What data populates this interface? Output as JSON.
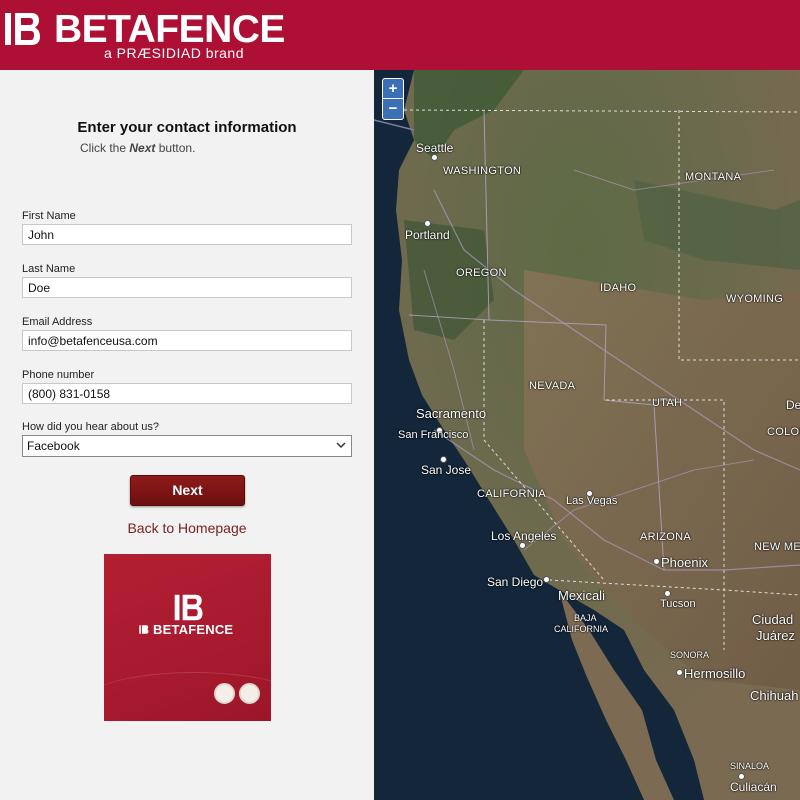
{
  "brand": {
    "name": "BETAFENCE",
    "tagline": "a PRÆSIDIAD brand"
  },
  "form": {
    "title": "Enter your contact information",
    "subtitle_prefix": "Click the",
    "subtitle_emph": "Next",
    "subtitle_suffix": "button.",
    "first_name": {
      "label": "First Name",
      "value": "John"
    },
    "last_name": {
      "label": "Last Name",
      "value": "Doe"
    },
    "email": {
      "label": "Email Address",
      "value": "info@betafenceusa.com"
    },
    "phone": {
      "label": "Phone number",
      "value": "(800) 831-0158"
    },
    "source": {
      "label": "How did you hear about us?",
      "selected": "Facebook"
    },
    "next_label": "Next",
    "back_label": "Back to Homepage"
  },
  "promo": {
    "word": "BETAFENCE"
  },
  "map": {
    "zoom_in": "+",
    "zoom_out": "−",
    "labels": {
      "seattle": "Seattle",
      "washington": "WASHINGTON",
      "montana": "MONTANA",
      "portland": "Portland",
      "oregon": "OREGON",
      "idaho": "IDAHO",
      "wyoming": "WYOMING",
      "nevada": "NEVADA",
      "sacramento": "Sacramento",
      "san_francisco": "San Francisco",
      "utah": "UTAH",
      "de": "De",
      "colo": "COLOI",
      "san_jose": "San Jose",
      "california": "CALIFORNIA",
      "las_vegas": "Las Vegas",
      "los_angeles": "Los Angeles",
      "arizona": "ARIZONA",
      "new_mex": "NEW ME",
      "phoenix": "Phoenix",
      "san_diego": "San Diego",
      "mexicali": "Mexicali",
      "tucson": "Tucson",
      "baja": "BAJA",
      "baja_cal": "CALIFORNIA",
      "ciudad": "Ciudad",
      "juarez": "Juárez",
      "sonora": "SONORA",
      "hermosillo": "Hermosillo",
      "chihua": "Chihuah",
      "sinaloa": "SINALOA",
      "culiacan": "Culiacán"
    }
  },
  "colors": {
    "brand": "#ad1034",
    "button": "#7d1415",
    "link": "#7a1e1e"
  }
}
